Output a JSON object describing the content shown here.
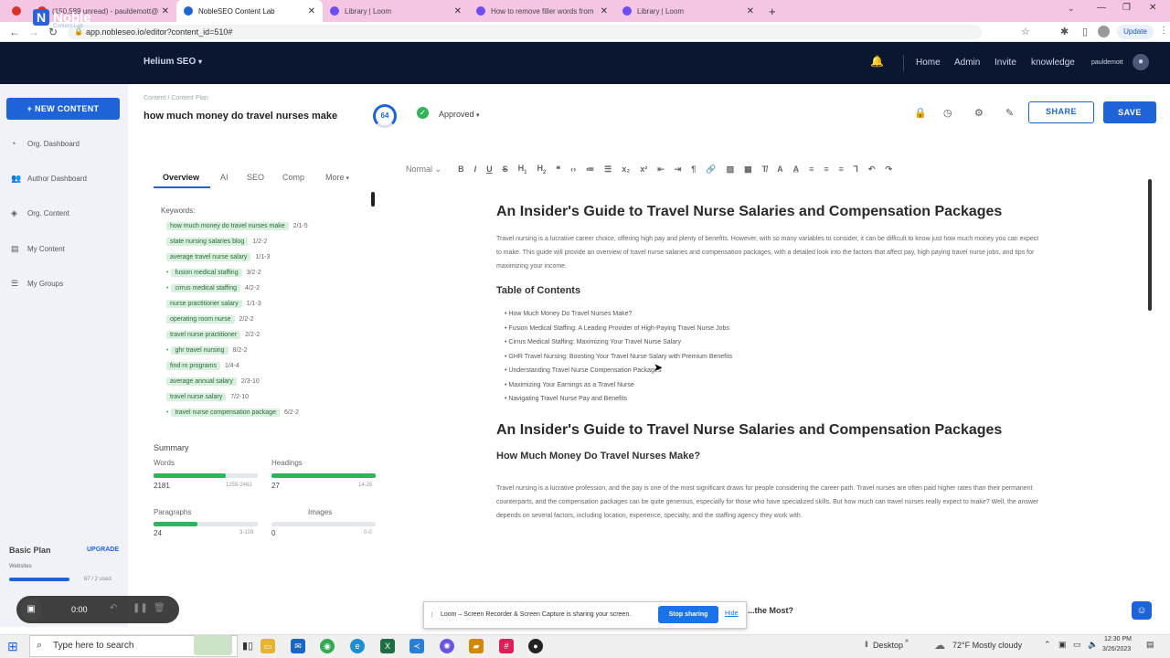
{
  "browser": {
    "tabs": [
      {
        "label": "(150,589 unread) - pauldemott@",
        "color": "#d93025"
      },
      {
        "label": "NobleSEO Content Lab",
        "color": "#1e64d8"
      },
      {
        "label": "Library | Loom",
        "color": "#6d4cf2"
      },
      {
        "label": "How to remove filler words from",
        "color": "#6d4cf2"
      },
      {
        "label": "Library | Loom",
        "color": "#6d4cf2"
      }
    ],
    "url": "app.nobleseo.io/editor?content_id=510#",
    "update_label": "Update"
  },
  "header": {
    "logo_text": "Noble",
    "logo_sub": "Content Lab",
    "workspace": "Helium SEO",
    "nav": [
      "Home",
      "Admin",
      "Invite",
      "knowledge"
    ],
    "username": "pauldemott"
  },
  "sidebar": {
    "new_content": "+ NEW CONTENT",
    "items": [
      "Org. Dashboard",
      "Author Dashboard",
      "Org. Content",
      "My Content",
      "My Groups"
    ],
    "plan_label": "Basic Plan",
    "upgrade_label": "UPGRADE",
    "websites_label": "Websites",
    "websites_count": "87 / 2 used"
  },
  "loom_controls": {
    "time": "0:00"
  },
  "editor": {
    "breadcrumb": "Content / Content Plan",
    "title": "how much money do travel nurses make",
    "score": "64",
    "status": "Approved",
    "share_label": "SHARE",
    "save_label": "SAVE"
  },
  "panel": {
    "tabs": [
      "Overview",
      "AI",
      "SEO",
      "Comp",
      "More"
    ],
    "keywords_label": "Keywords:",
    "keywords": [
      {
        "term": "how much money do travel nurses make",
        "count": "2/1-5"
      },
      {
        "term": "state nursing salaries blog",
        "count": "1/2-2"
      },
      {
        "term": "average travel nurse salary",
        "count": "1/1-3"
      },
      {
        "term": "fusion medical staffing",
        "count": "3/2-2"
      },
      {
        "term": "cirrus medical staffing",
        "count": "4/2-2"
      },
      {
        "term": "nurse practitioner salary",
        "count": "1/1-3"
      },
      {
        "term": "operating room nurse",
        "count": "2/2-2"
      },
      {
        "term": "travel nurse practitioner",
        "count": "2/2-2"
      },
      {
        "term": "ghr travel nursing",
        "count": "8/2-2"
      },
      {
        "term": "find rn programs",
        "count": "1/4-4"
      },
      {
        "term": "average annual salary",
        "count": "2/3-10"
      },
      {
        "term": "travel nurse salary",
        "count": "7/2-10"
      },
      {
        "term": "travel nurse compensation package",
        "count": "6/2-2"
      }
    ],
    "summary_label": "Summary",
    "summary": {
      "words_label": "Words",
      "words_value": "2181",
      "words_range": "1255-2462",
      "words_progress": 0.69,
      "headings_label": "Headings",
      "headings_value": "27",
      "headings_range": "14-26",
      "headings_progress": 1.0,
      "paragraphs_label": "Paragraphs",
      "paragraphs_value": "24",
      "paragraphs_range": "3-109",
      "paragraphs_progress": 0.42,
      "images_label": "Images",
      "images_value": "0",
      "images_range": "0-0",
      "images_progress": 0.0
    }
  },
  "toolbar": {
    "style": "Normal"
  },
  "article": {
    "h1": "An Insider's Guide to Travel Nurse Salaries and Compensation Packages",
    "intro": "Travel nursing is a lucrative career choice, offering high pay and plenty of benefits. However, with so many variables to consider, it can be difficult to know just how much money you can expect to make. This guide will provide an overview of travel nurse salaries and compensation packages, with a detailed look into the factors that affect pay, high paying travel nurse jobs, and tips for maximizing your income.",
    "toc_title": "Table of Contents",
    "toc": [
      "How Much Money Do Travel Nurses Make?",
      "Fusion Medical Staffing: A Leading Provider of High-Paying Travel Nurse Jobs",
      "Cirrus Medical Staffing: Maximizing Your Travel Nurse Salary",
      "GHR Travel Nursing: Boosting Your Travel Nurse Salary with Premium Benefits",
      "Understanding Travel Nurse Compensation Packages",
      "Maximizing Your Earnings as a Travel Nurse",
      "Navigating Travel Nurse Pay and Benefits"
    ],
    "h1_repeat": "An Insider's Guide to Travel Nurse Salaries and Compensation Packages",
    "h2": "How Much Money Do Travel Nurses Make?",
    "body": "Travel nursing is a lucrative profession, and the pay is one of the most significant draws for people considering the career path. Travel nurses are often paid higher rates than their permanent counterparts, and the compensation packages can be quite generous, especially for those who have specialized skills. But how much can travel nurses really expect to make? Well, the answer depends on several factors, including location, experience, specialty, and the staffing agency they work with.",
    "partial_heading": "...the Most?"
  },
  "loom_share": {
    "message": "Loom – Screen Recorder & Screen Capture is sharing your screen.",
    "stop_label": "Stop sharing",
    "hide_label": "Hide"
  },
  "taskbar": {
    "search_placeholder": "Type here to search",
    "desktop_label": "Desktop",
    "weather": "72°F  Mostly cloudy",
    "time": "12:30 PM",
    "date": "3/26/2023"
  }
}
